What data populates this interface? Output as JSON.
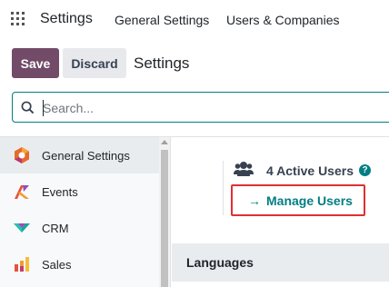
{
  "navbar": {
    "brand": "Settings",
    "menu": [
      "General Settings",
      "Users & Companies"
    ]
  },
  "control_panel": {
    "save_label": "Save",
    "discard_label": "Discard",
    "title": "Settings"
  },
  "search": {
    "placeholder": "Search..."
  },
  "sidebar": {
    "items": [
      {
        "label": "General Settings",
        "icon": "general-settings-icon",
        "active": true
      },
      {
        "label": "Events",
        "icon": "events-icon",
        "active": false
      },
      {
        "label": "CRM",
        "icon": "crm-icon",
        "active": false
      },
      {
        "label": "Sales",
        "icon": "sales-icon",
        "active": false
      }
    ]
  },
  "users": {
    "count_label": "4 Active Users",
    "manage_label": "Manage Users",
    "manage_arrow": "→",
    "help": "?"
  },
  "sections": {
    "languages": "Languages"
  },
  "colors": {
    "primary": "#714b67",
    "accent": "#017e84",
    "highlight_border": "#e03030"
  }
}
